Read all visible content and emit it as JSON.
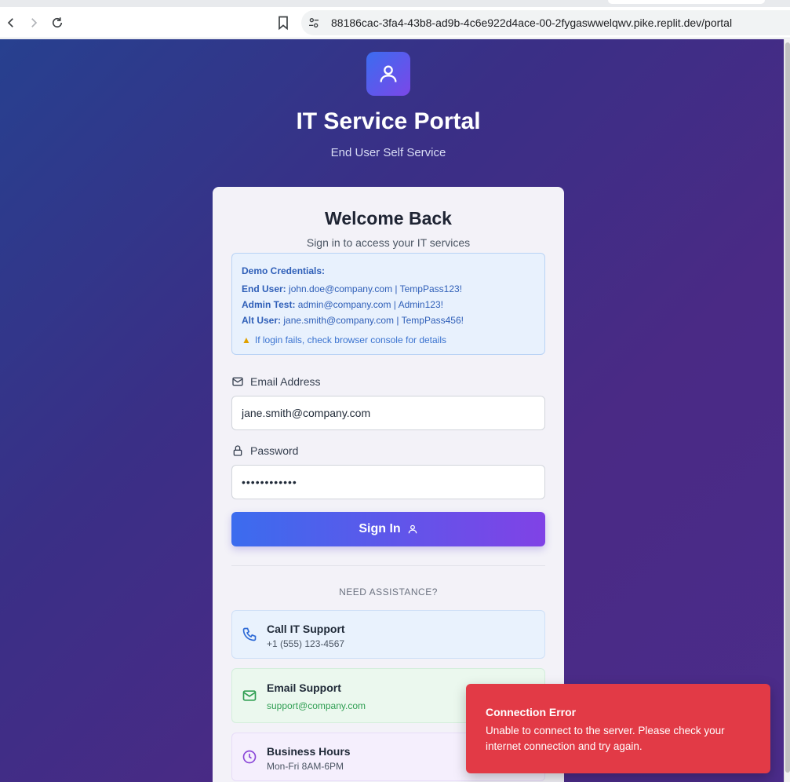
{
  "browser": {
    "url": "88186cac-3fa4-43b8-ad9b-4c6e922d4ace-00-2fygaswwelqwv.pike.replit.dev/portal"
  },
  "header": {
    "title": "IT Service Portal",
    "subtitle": "End User Self Service"
  },
  "login": {
    "title": "Welcome Back",
    "subtitle": "Sign in to access your IT services",
    "demo": {
      "title": "Demo Credentials:",
      "lines": [
        {
          "label": "End User:",
          "value": "john.doe@company.com | TempPass123!"
        },
        {
          "label": "Admin Test:",
          "value": "admin@company.com | Admin123!"
        },
        {
          "label": "Alt User:",
          "value": "jane.smith@company.com | TempPass456!"
        }
      ],
      "warning": "If login fails, check browser console for details"
    },
    "email_label": "Email Address",
    "email_value": "jane.smith@company.com",
    "password_label": "Password",
    "password_value": "••••••••••••",
    "submit_label": "Sign In"
  },
  "assistance": {
    "heading": "NEED ASSISTANCE?",
    "items": [
      {
        "title": "Call IT Support",
        "value": "+1 (555) 123-4567",
        "icon": "phone-icon"
      },
      {
        "title": "Email Support",
        "value": "support@company.com",
        "icon": "mail-icon"
      },
      {
        "title": "Business Hours",
        "value": "Mon-Fri 8AM-6PM",
        "icon": "clock-icon"
      }
    ]
  },
  "toast": {
    "title": "Connection Error",
    "message": "Unable to connect to the server. Please check your internet connection and try again."
  },
  "colors": {
    "accent_blue": "#3b6cee",
    "accent_purple": "#8042e6",
    "error": "#e23a46"
  }
}
